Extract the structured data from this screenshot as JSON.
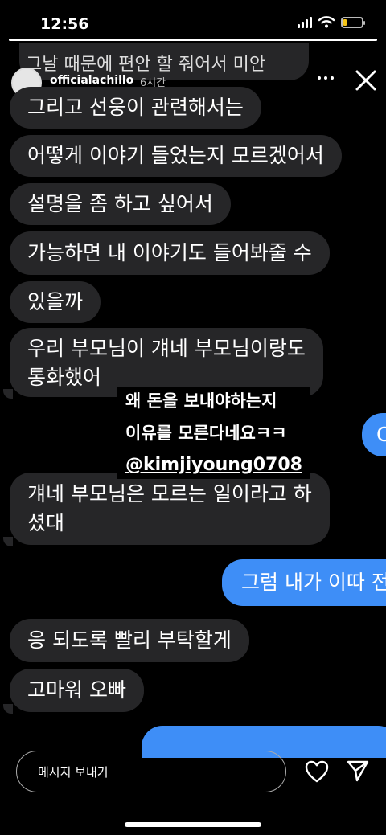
{
  "status_bar": {
    "time": "12:56",
    "battery_level": 0.2
  },
  "story": {
    "progress": 1.0,
    "username": "officialachillo",
    "time_ago": "6시간",
    "icons": [
      "more-icon",
      "close-icon"
    ]
  },
  "messages": {
    "cut_top": "그날 때문에 편안 할 줘어서 미안",
    "m1": "그리고 선웅이 관련해서는",
    "m2": "어떻게 이야기 들었는지 모르겠어서",
    "m3": "설명을 좀 하고 싶어서",
    "m4": "가능하면 내 이야기도 들어봐줄 수",
    "m5": "있을까",
    "m6_line1": "우리 부모님이 걔네 부모님이랑도",
    "m6_line2": "통화했어",
    "m7_line1": "걔네 부모님은 모르는 일이라고 하",
    "m7_line2": "셨대",
    "m8": "응 되도록 빨리 부탁할게",
    "m9": "고마워 오빠",
    "out1": "그럼 내가 이따 전",
    "out_edge": "O"
  },
  "sticker": {
    "line1": "왜 돈을 보내야하는지",
    "line2": "이유를 모른다네요ㅋㅋ",
    "line3": "@kimjiyoung0708"
  },
  "reply": {
    "placeholder": "메시지 보내기",
    "icons": [
      "heart-icon",
      "send-icon"
    ]
  },
  "colors": {
    "incoming_bubble": "#262628",
    "outgoing_bubble": "#3e8ef7",
    "battery": "#f5c518"
  }
}
